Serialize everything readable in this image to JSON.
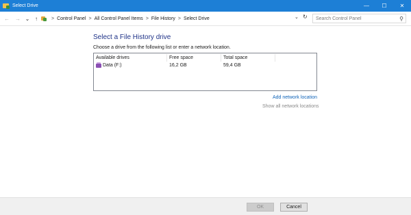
{
  "window": {
    "title": "Select Drive",
    "controls": {
      "minimize": "—",
      "maximize": "☐",
      "close": "✕"
    }
  },
  "nav": {
    "back": "←",
    "forward": "→",
    "recent": "⌄",
    "up": "↑"
  },
  "breadcrumb": {
    "separator": ">",
    "items": [
      "Control Panel",
      "All Control Panel Items",
      "File History",
      "Select Drive"
    ]
  },
  "address": {
    "dropdown": "⌄",
    "refresh": "↻"
  },
  "search": {
    "placeholder": "Search Control Panel",
    "icon": "⚲"
  },
  "content": {
    "heading": "Select a File History drive",
    "subtext": "Choose a drive from the following list or enter a network location.",
    "table": {
      "columns": [
        "Available drives",
        "Free space",
        "Total space"
      ],
      "rows": [
        {
          "drive": "Data (F:)",
          "free": "16,2 GB",
          "total": "59,4 GB"
        }
      ]
    },
    "add_network_location": "Add network location",
    "show_all_network_locations": "Show all network locations"
  },
  "footer": {
    "ok": "OK",
    "cancel": "Cancel"
  },
  "colors": {
    "titlebar": "#1d7fd6",
    "heading": "#1e3287",
    "link": "#0f63b8"
  }
}
